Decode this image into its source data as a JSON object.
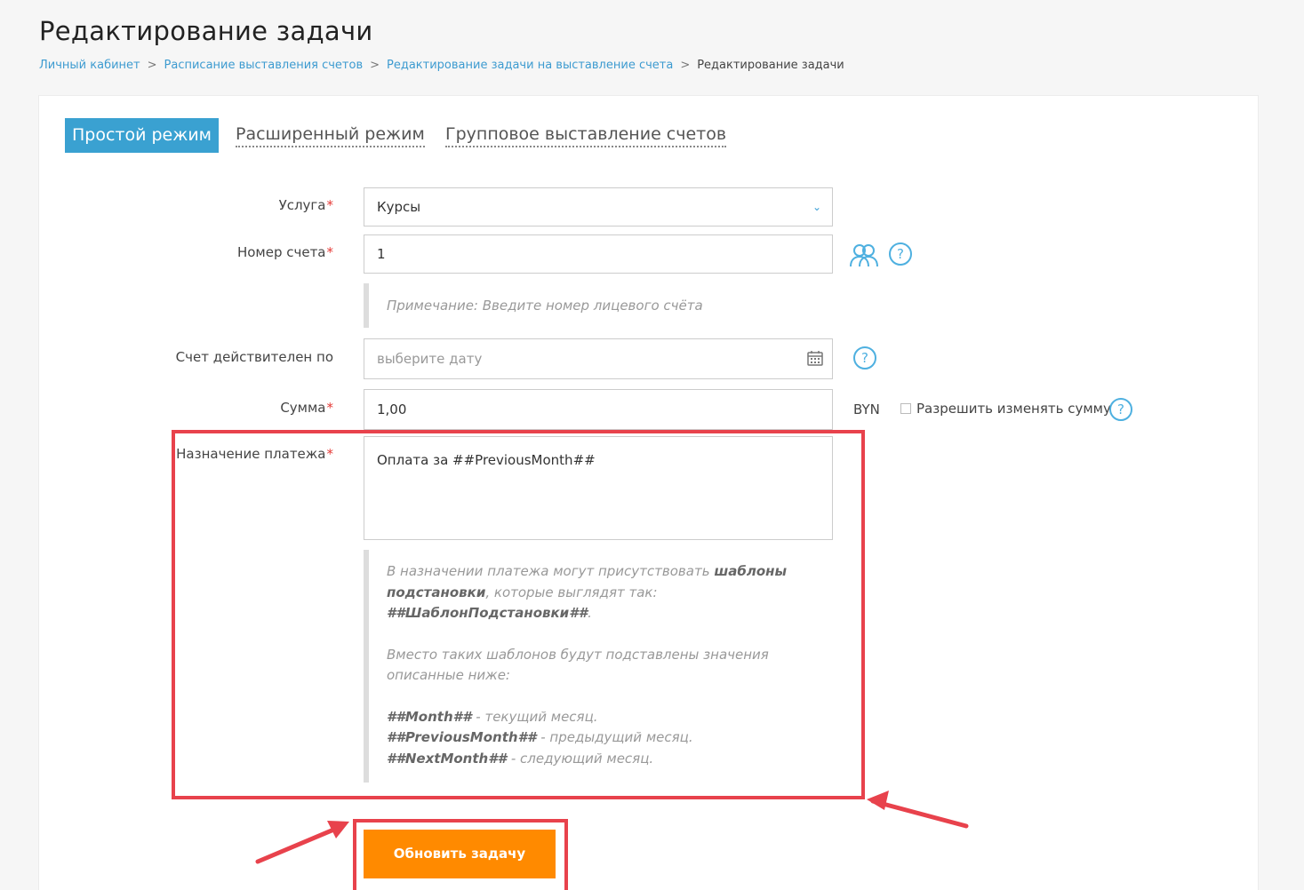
{
  "page": {
    "title": "Редактирование задачи"
  },
  "breadcrumb": {
    "items": [
      "Личный кабинет",
      "Расписание выставления счетов",
      "Редактирование задачи на выставление счета"
    ],
    "current": "Редактирование задачи",
    "separator": ">"
  },
  "tabs": [
    {
      "label": "Простой режим",
      "active": true
    },
    {
      "label": "Расширенный режим",
      "active": false
    },
    {
      "label": "Групповое выставление счетов",
      "active": false
    }
  ],
  "form": {
    "required_mark": "*",
    "service": {
      "label": "Услуга",
      "value": "Курсы"
    },
    "account": {
      "label": "Номер счета",
      "value": "1",
      "note": "Примечание: Введите номер лицевого счёта"
    },
    "valid_until": {
      "label": "Счет действителен по",
      "placeholder": "выберите дату"
    },
    "amount": {
      "label": "Сумма",
      "value": "1,00",
      "currency": "BYN",
      "allow_change_label": "Разрешить изменять сумму",
      "allow_change_checked": false
    },
    "purpose": {
      "label": "Назначение платежа",
      "value": "Оплата за ##PreviousMonth##",
      "note": {
        "p1_start": "В назначении платежа могут присутствовать",
        "p1_bold": "шаблоны подстановки",
        "p1_mid": ", которые выглядят так:",
        "p1_example": "##ШаблонПодстановки##",
        "p1_end": ".",
        "p2": "Вместо таких шаблонов будут подставлены значения описанные ниже:",
        "templates": [
          {
            "code": "##Month##",
            "desc": " - текущий месяц."
          },
          {
            "code": "##PreviousMonth##",
            "desc": " - предыдущий месяц."
          },
          {
            "code": "##NextMonth##",
            "desc": " - следующий месяц."
          }
        ]
      }
    },
    "submit_label": "Обновить задачу"
  },
  "icons": {
    "help": "help-question-icon",
    "users": "users-icon",
    "calendar": "calendar-icon",
    "chevron": "chevron-down-icon"
  },
  "colors": {
    "accent": "#3aa1d1",
    "submit": "#ff8a00",
    "required": "#e53935",
    "annotation": "#e8424c"
  }
}
